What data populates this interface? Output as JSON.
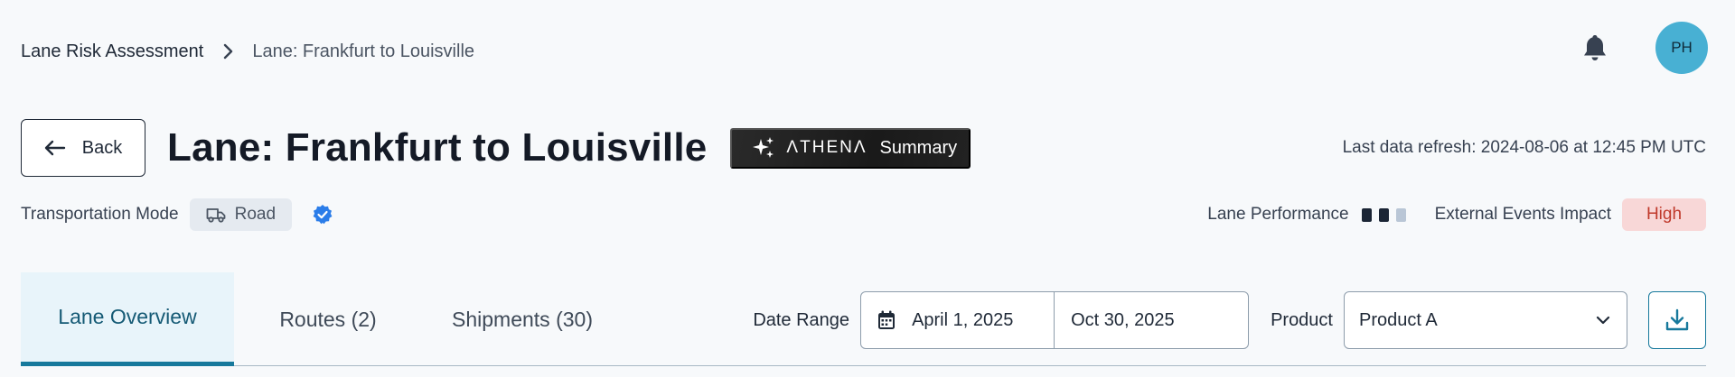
{
  "breadcrumb": {
    "root": "Lane Risk Assessment",
    "current": "Lane: Frankfurt to Louisville"
  },
  "header": {
    "avatar_initials": "PH",
    "back_label": "Back",
    "title": "Lane: Frankfurt to Louisville",
    "athena_brand": "ΛTHENΛ",
    "athena_action": "Summary",
    "last_refresh": "Last data refresh: 2024-08-06 at 12:45 PM UTC"
  },
  "meta": {
    "transport_label": "Transportation Mode",
    "transport_mode": "Road",
    "lane_performance_label": "Lane Performance",
    "lane_performance_level": 2,
    "lane_performance_max": 3,
    "external_events_label": "External Events Impact",
    "external_events_value": "High"
  },
  "tabs": [
    {
      "label": "Lane Overview",
      "active": true
    },
    {
      "label": "Routes (2)",
      "active": false
    },
    {
      "label": "Shipments (30)",
      "active": false
    }
  ],
  "filters": {
    "date_range_label": "Date Range",
    "date_start": "April 1, 2025",
    "date_end": "Oct 30, 2025",
    "product_label": "Product",
    "product_value": "Product A"
  },
  "colors": {
    "accent": "#17799c",
    "avatar": "#48b0d3",
    "perf_filled": "#1b2535",
    "perf_empty": "#b9c6d6",
    "impact_bg": "#f8d7d7",
    "impact_text": "#c0392b",
    "verified": "#2b7de9"
  },
  "icons": {
    "breadcrumb_separator": "chevron-right-icon",
    "notifications": "bell-icon",
    "back": "arrow-left-icon",
    "athena": "sparkle-icon",
    "transport": "truck-icon",
    "verified": "verified-badge-icon",
    "date": "calendar-icon",
    "product_select": "chevron-down-icon",
    "download": "download-icon"
  }
}
